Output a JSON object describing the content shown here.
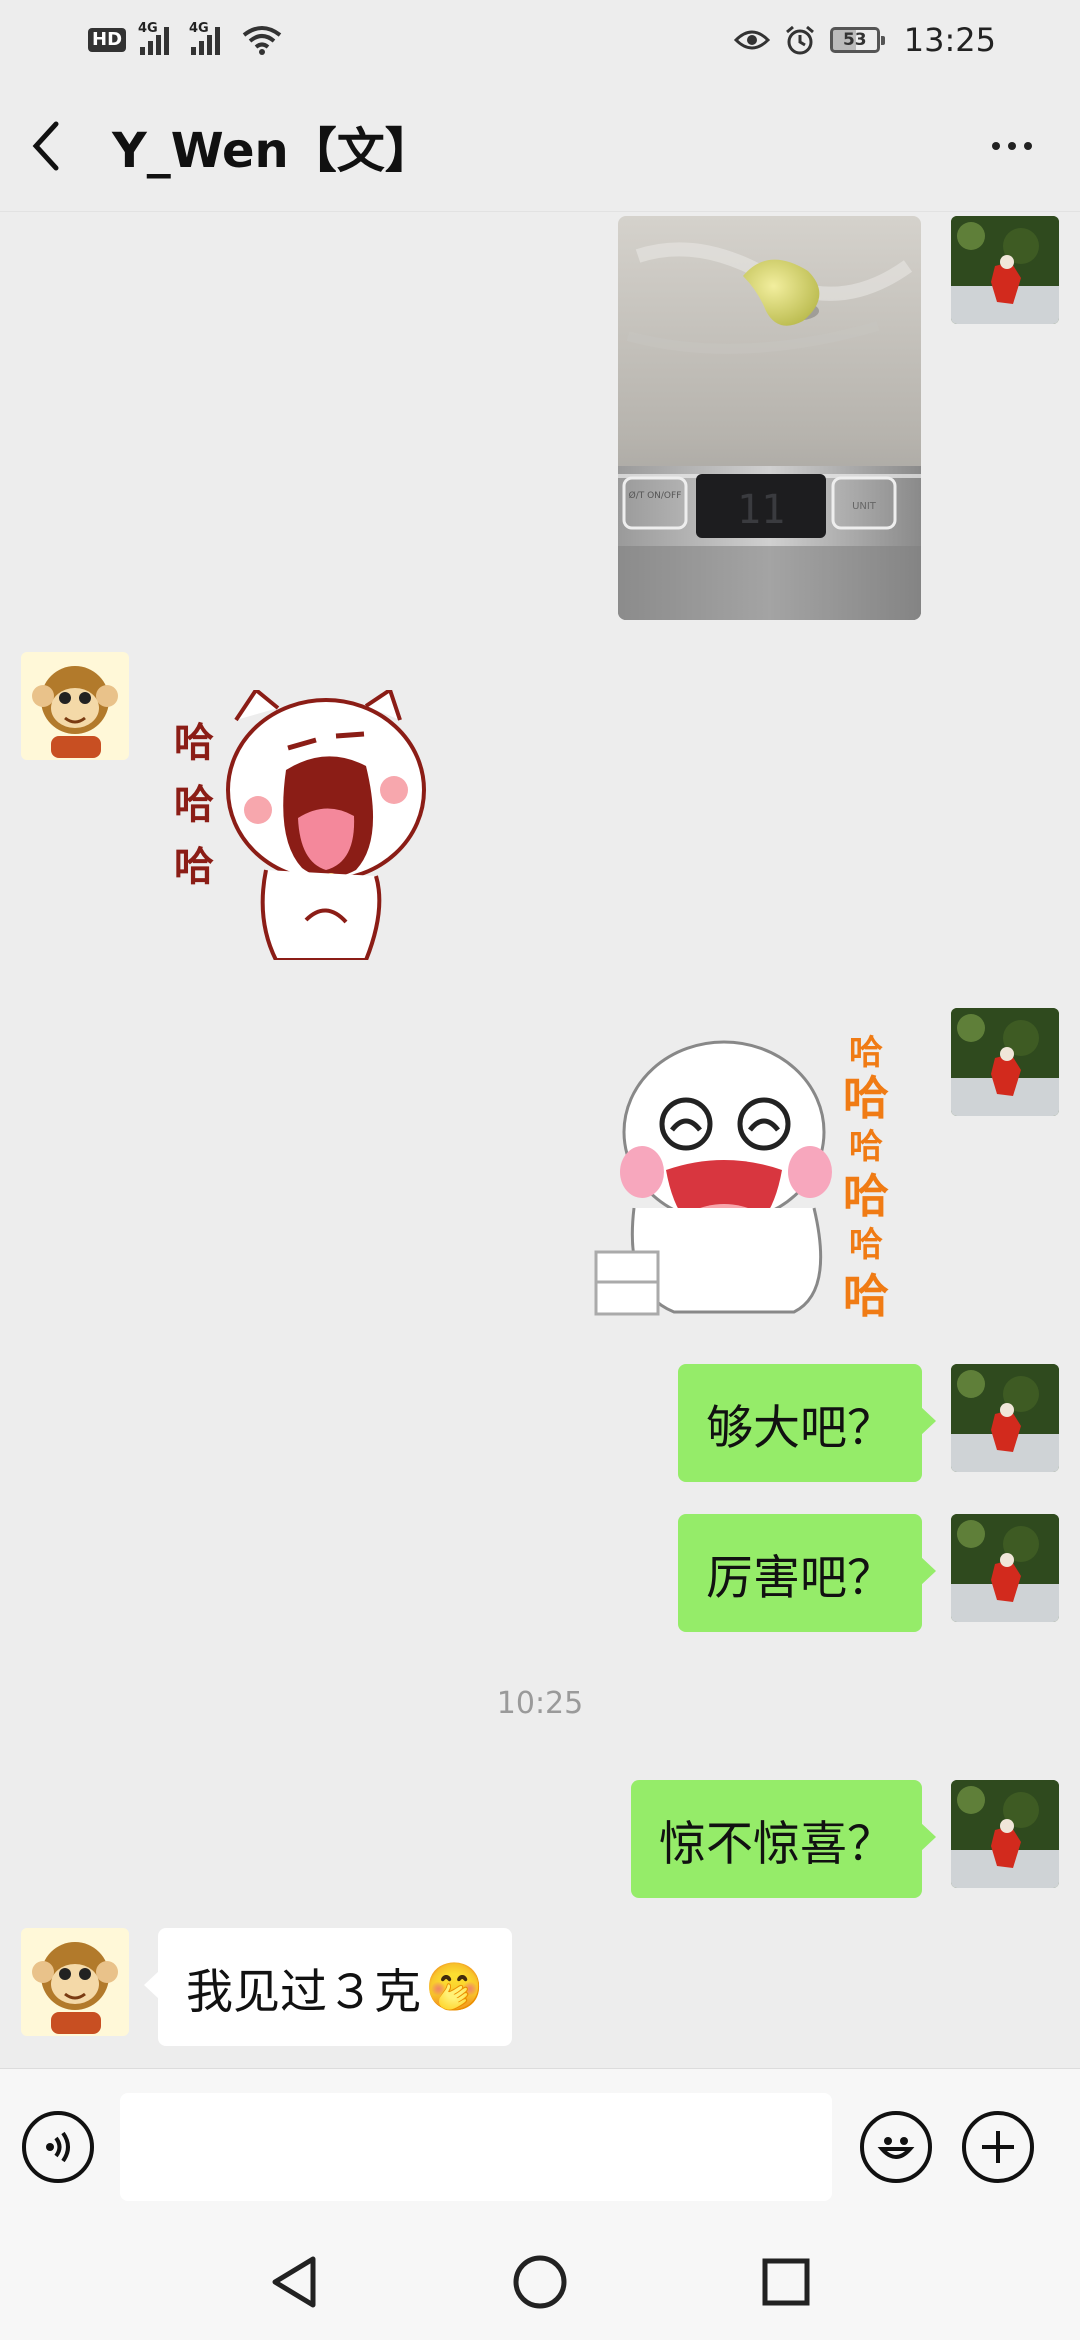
{
  "status_bar": {
    "hd_label": "HD",
    "net_1": "4G",
    "net_2": "4G",
    "battery": "53",
    "time": "13:25"
  },
  "header": {
    "title": "Y_Wen【文】",
    "icons": {
      "back": "chevron-left-icon",
      "more": "more-dots-icon"
    }
  },
  "messages": {
    "m1": {
      "sender": "me",
      "type": "image",
      "scale_display": "11",
      "scale_left_label": "Ø/T ON/OFF",
      "scale_right_label": "UNIT"
    },
    "m2": {
      "sender": "them",
      "type": "sticker",
      "caption": [
        "哈",
        "哈",
        "哈"
      ]
    },
    "m3": {
      "sender": "me",
      "type": "sticker",
      "caption": [
        "哈",
        "哈",
        "哈",
        "哈",
        "哈",
        "哈"
      ]
    },
    "m4": {
      "sender": "me",
      "type": "text",
      "text": "够大吧？"
    },
    "m5": {
      "sender": "me",
      "type": "text",
      "text": "厉害吧？"
    },
    "ts": {
      "type": "timestamp",
      "text": "10:25"
    },
    "m6": {
      "sender": "me",
      "type": "text",
      "text": "惊不惊喜？"
    },
    "m7": {
      "sender": "them",
      "type": "text",
      "text": "我见过３克",
      "emoji": "🤭"
    }
  },
  "input_bar": {
    "placeholder": "",
    "icons": {
      "voice": "voice-icon",
      "emoji": "emoji-icon",
      "plus": "plus-icon"
    }
  },
  "nav_bar": {
    "icons": [
      "back-triangle-icon",
      "home-circle-icon",
      "recents-square-icon"
    ]
  },
  "colors": {
    "me_bubble": "#95ec69",
    "them_bubble": "#ffffff",
    "chat_bg": "#ededed"
  }
}
